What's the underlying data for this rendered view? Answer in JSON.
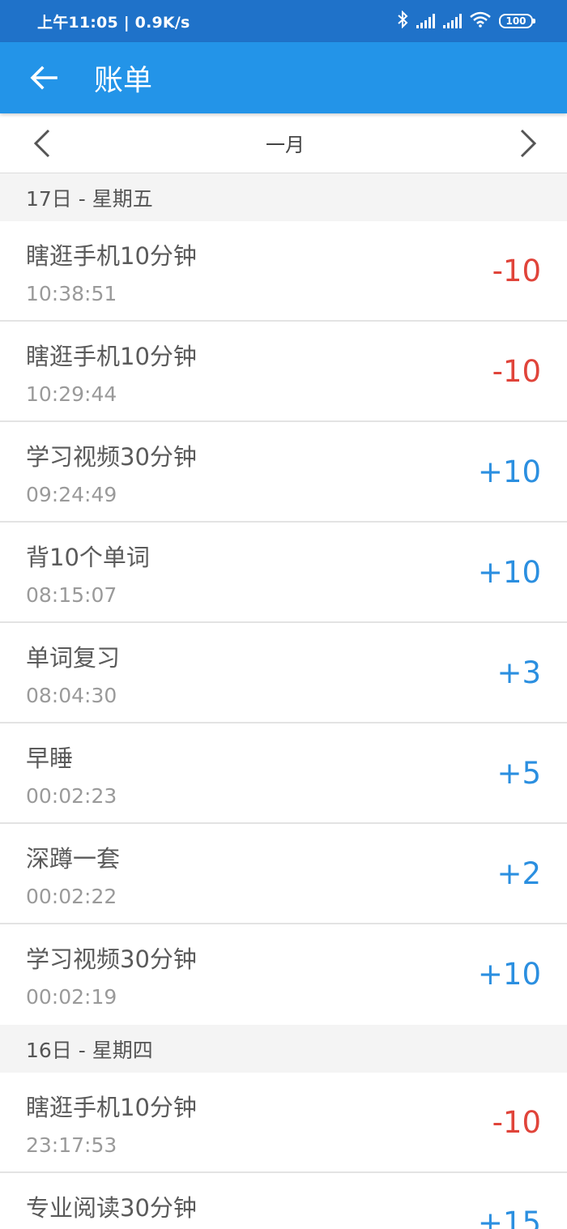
{
  "status_bar": {
    "time_speed": "上午11:05 | 0.9K/s",
    "battery": "100",
    "icons": [
      "bluetooth-icon",
      "signal-icon",
      "signal-roaming-icon",
      "wifi-icon",
      "battery-icon"
    ]
  },
  "app_bar": {
    "title": "账单",
    "back_icon": "arrow-left-icon"
  },
  "month_nav": {
    "label": "一月",
    "prev_icon": "chevron-left-icon",
    "next_icon": "chevron-right-icon"
  },
  "colors": {
    "status_bar": "#1f72c9",
    "app_bar": "#2394e8",
    "negative": "#e0443a",
    "positive": "#2b8fe0"
  },
  "sections": [
    {
      "header": "17日 - 星期五",
      "items": [
        {
          "title": "瞎逛手机10分钟",
          "time": "10:38:51",
          "amount": "-10"
        },
        {
          "title": "瞎逛手机10分钟",
          "time": "10:29:44",
          "amount": "-10"
        },
        {
          "title": "学习视频30分钟",
          "time": "09:24:49",
          "amount": "+10"
        },
        {
          "title": "背10个单词",
          "time": "08:15:07",
          "amount": "+10"
        },
        {
          "title": "单词复习",
          "time": "08:04:30",
          "amount": "+3"
        },
        {
          "title": "早睡",
          "time": "00:02:23",
          "amount": "+5"
        },
        {
          "title": "深蹲一套",
          "time": "00:02:22",
          "amount": "+2"
        },
        {
          "title": "学习视频30分钟",
          "time": "00:02:19",
          "amount": "+10"
        }
      ]
    },
    {
      "header": "16日 - 星期四",
      "items": [
        {
          "title": "瞎逛手机10分钟",
          "time": "23:17:53",
          "amount": "-10"
        },
        {
          "title": "专业阅读30分钟",
          "time": "",
          "amount": "+15"
        }
      ]
    }
  ]
}
